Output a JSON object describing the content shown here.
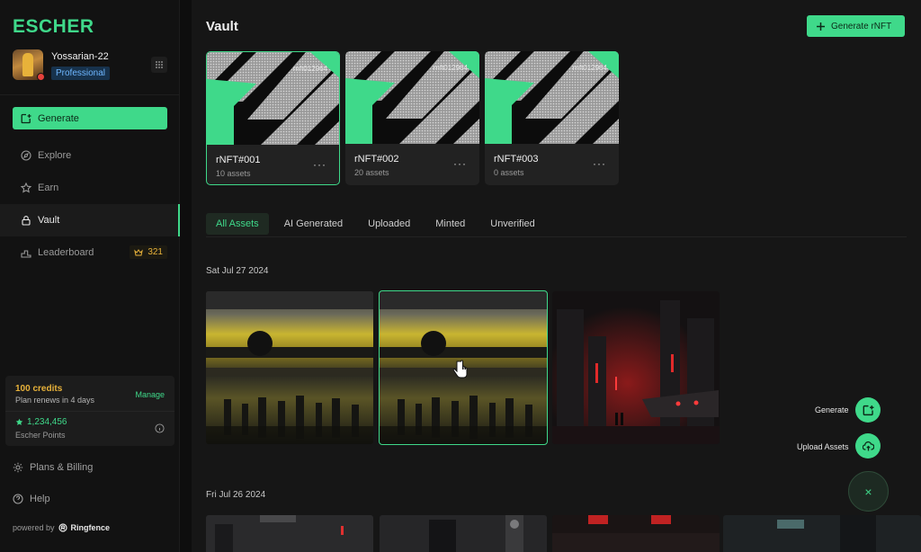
{
  "app": {
    "logo": "ESCHER"
  },
  "profile": {
    "username": "Yossarian-22",
    "plan": "Professional"
  },
  "sidebar": {
    "generate_label": "Generate",
    "items": [
      {
        "label": "Explore",
        "icon": "compass-icon"
      },
      {
        "label": "Earn",
        "icon": "star-icon"
      },
      {
        "label": "Vault",
        "icon": "lock-icon",
        "active": true
      },
      {
        "label": "Leaderboard",
        "icon": "podium-icon",
        "badge": "321"
      }
    ],
    "credits": {
      "title": "100 credits",
      "renew": "Plan renews in 4 days",
      "manage": "Manage",
      "points": "1,234,456",
      "points_label": "Escher Points"
    },
    "plans_billing": "Plans & Billing",
    "help": "Help",
    "powered_by": "powered by",
    "brand": "Ringfence"
  },
  "main": {
    "title": "Vault",
    "generate_rnft": "Generate rNFT",
    "rnfts": [
      {
        "name": "rNFT#001",
        "assets": "10 assets",
        "code": "rnft012964",
        "selected": true
      },
      {
        "name": "rNFT#002",
        "assets": "20 assets",
        "code": "rnft012964"
      },
      {
        "name": "rNFT#003",
        "assets": "0 assets",
        "code": "rnft012964"
      }
    ],
    "tabs": [
      "All Assets",
      "AI Generated",
      "Uploaded",
      "Minted",
      "Unverified"
    ],
    "active_tab": "All Assets",
    "dates": [
      "Sat Jul 27 2024",
      "Fri Jul 26 2024"
    ]
  },
  "fab": {
    "generate": "Generate",
    "upload": "Upload Assets"
  },
  "colors": {
    "accent": "#3fd98a",
    "badge_blue": "#6fb7ff",
    "gold": "#e8b23a"
  }
}
